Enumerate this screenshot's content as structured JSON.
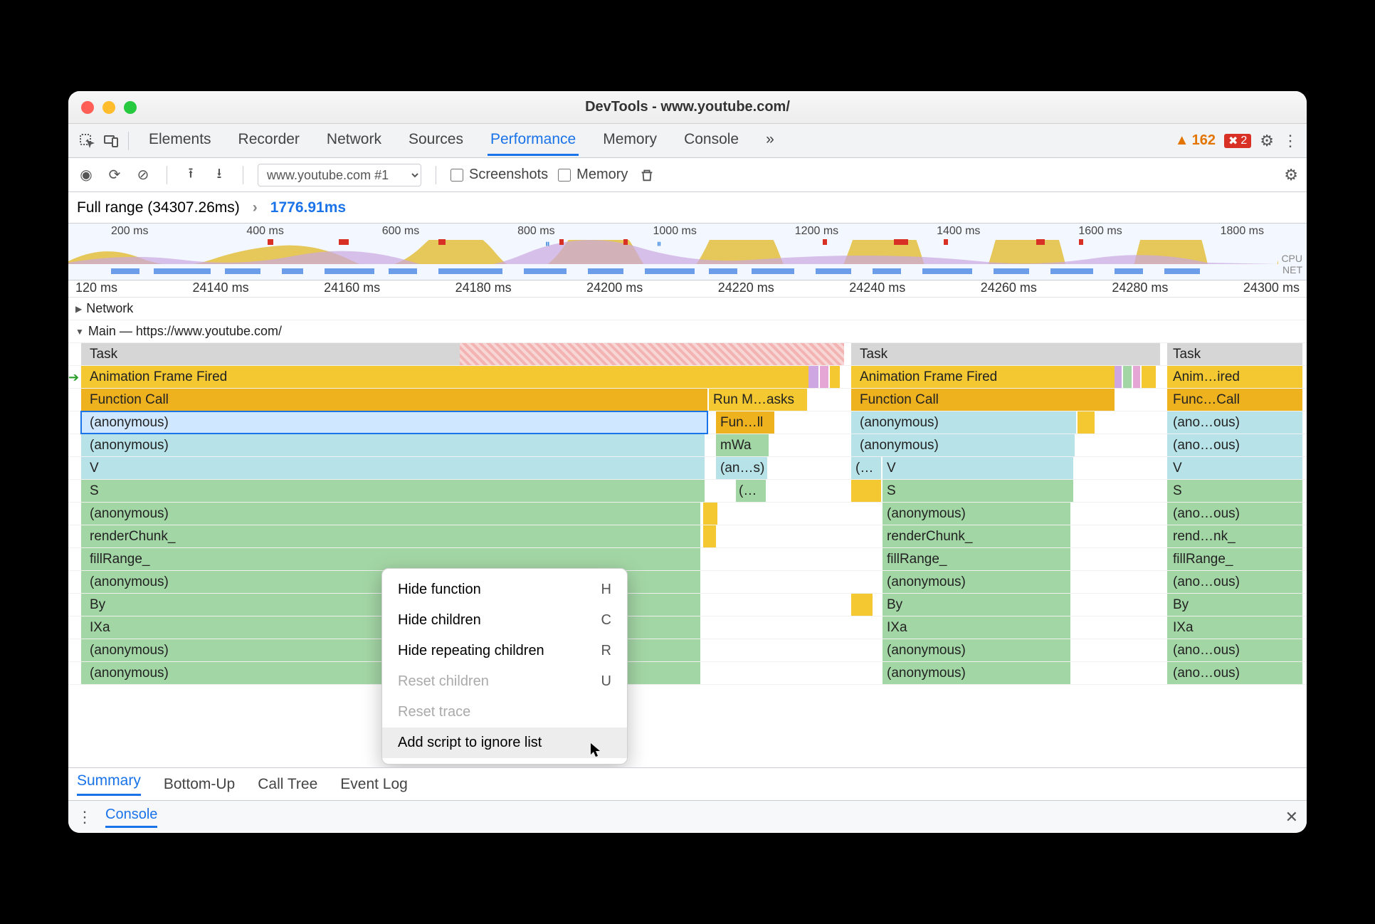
{
  "window": {
    "title": "DevTools - www.youtube.com/"
  },
  "tabs": {
    "items": [
      "Elements",
      "Recorder",
      "Network",
      "Sources",
      "Performance",
      "Memory",
      "Console"
    ],
    "active": "Performance",
    "overflow": "»"
  },
  "warnings": {
    "count": "162"
  },
  "errors": {
    "count": "2"
  },
  "recording": {
    "dropdown": "www.youtube.com #1",
    "checkboxes": {
      "screenshots": "Screenshots",
      "memory": "Memory"
    }
  },
  "breadcrumb": {
    "full": "Full range (34307.26ms)",
    "chevron": "›",
    "selected": "1776.91ms"
  },
  "overview": {
    "ticks": [
      "200 ms",
      "400 ms",
      "600 ms",
      "800 ms",
      "1000 ms",
      "1200 ms",
      "1400 ms",
      "1600 ms",
      "1800 ms"
    ],
    "cpu_label": "CPU",
    "net_label": "NET"
  },
  "detail_ticks": [
    "120 ms",
    "24140 ms",
    "24160 ms",
    "24180 ms",
    "24200 ms",
    "24220 ms",
    "24240 ms",
    "24260 ms",
    "24280 ms",
    "24300 ms"
  ],
  "tracks": {
    "network": "Network",
    "main": "Main — https://www.youtube.com/"
  },
  "flame": {
    "colA": {
      "rows": [
        {
          "label": "Task",
          "color": "gray"
        },
        {
          "label": "Animation Frame Fired",
          "color": "orange"
        },
        {
          "label": "Function Call",
          "color": "orange2",
          "tail": "Run M…asks"
        },
        {
          "label": "(anonymous)",
          "color": "cyan",
          "tail": "Fun…ll",
          "selected": true
        },
        {
          "label": "(anonymous)",
          "color": "cyan",
          "tail": "mWa"
        },
        {
          "label": "V",
          "color": "cyan",
          "tail": "(an…s)"
        },
        {
          "label": "S",
          "color": "green",
          "tail": "(…"
        },
        {
          "label": "(anonymous)",
          "color": "green"
        },
        {
          "label": "renderChunk_",
          "color": "green"
        },
        {
          "label": "fillRange_",
          "color": "green"
        },
        {
          "label": "(anonymous)",
          "color": "green"
        },
        {
          "label": "By",
          "color": "green"
        },
        {
          "label": "IXa",
          "color": "green"
        },
        {
          "label": "(anonymous)",
          "color": "green"
        },
        {
          "label": "(anonymous)",
          "color": "green"
        }
      ]
    },
    "colB": {
      "rows": [
        {
          "label": "Task",
          "color": "gray"
        },
        {
          "label": "Animation Frame Fired",
          "color": "orange"
        },
        {
          "label": "Function Call",
          "color": "orange2"
        },
        {
          "label": "(anonymous)",
          "color": "cyan"
        },
        {
          "label": "(anonymous)",
          "color": "cyan"
        },
        {
          "label": "(…",
          "label2": "V",
          "color": "cyan"
        },
        {
          "label": "S",
          "color": "green"
        },
        {
          "label": "(anonymous)",
          "color": "green"
        },
        {
          "label": "renderChunk_",
          "color": "green"
        },
        {
          "label": "fillRange_",
          "color": "green"
        },
        {
          "label": "(anonymous)",
          "color": "green"
        },
        {
          "label": "By",
          "color": "green"
        },
        {
          "label": "IXa",
          "color": "green"
        },
        {
          "label": "(anonymous)",
          "color": "green"
        },
        {
          "label": "(anonymous)",
          "color": "green"
        }
      ]
    },
    "colC": {
      "rows": [
        {
          "label": "Task",
          "color": "gray"
        },
        {
          "label": "Anim…ired",
          "color": "orange"
        },
        {
          "label": "Func…Call",
          "color": "orange2"
        },
        {
          "label": "(ano…ous)",
          "color": "cyan"
        },
        {
          "label": "(ano…ous)",
          "color": "cyan"
        },
        {
          "label": "V",
          "color": "cyan"
        },
        {
          "label": "S",
          "color": "green"
        },
        {
          "label": "(ano…ous)",
          "color": "green"
        },
        {
          "label": "rend…nk_",
          "color": "green"
        },
        {
          "label": "fillRange_",
          "color": "green"
        },
        {
          "label": "(ano…ous)",
          "color": "green"
        },
        {
          "label": "By",
          "color": "green"
        },
        {
          "label": "IXa",
          "color": "green"
        },
        {
          "label": "(ano…ous)",
          "color": "green"
        },
        {
          "label": "(ano…ous)",
          "color": "green"
        }
      ]
    }
  },
  "context_menu": {
    "items": [
      {
        "label": "Hide function",
        "key": "H",
        "enabled": true
      },
      {
        "label": "Hide children",
        "key": "C",
        "enabled": true
      },
      {
        "label": "Hide repeating children",
        "key": "R",
        "enabled": true
      },
      {
        "label": "Reset children",
        "key": "U",
        "enabled": false
      },
      {
        "label": "Reset trace",
        "key": "",
        "enabled": false
      },
      {
        "label": "Add script to ignore list",
        "key": "",
        "enabled": true,
        "hovered": true
      }
    ]
  },
  "bottom_tabs": {
    "items": [
      "Summary",
      "Bottom-Up",
      "Call Tree",
      "Event Log"
    ],
    "active": "Summary"
  },
  "console": {
    "label": "Console"
  }
}
